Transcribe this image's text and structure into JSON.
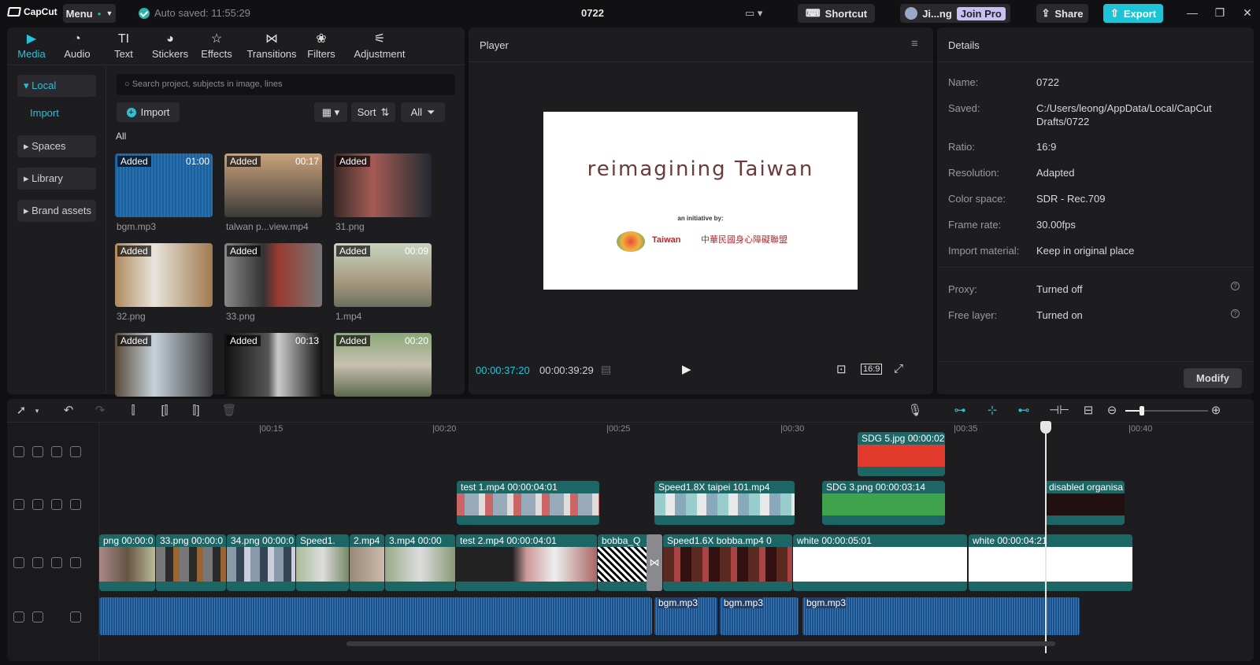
{
  "app": {
    "logo": "CapCut",
    "menu": "Menu",
    "autosave": "Auto saved: 11:55:29",
    "project_title": "0722",
    "shortcut": "Shortcut",
    "user": "Ji...ng",
    "join_pro": "Join Pro",
    "share": "Share",
    "export": "Export"
  },
  "media": {
    "tabs": [
      {
        "label": "Media",
        "icon": "media-icon"
      },
      {
        "label": "Audio",
        "icon": "audio-icon"
      },
      {
        "label": "Text",
        "icon": "text-icon"
      },
      {
        "label": "Stickers",
        "icon": "stickers-icon"
      },
      {
        "label": "Effects",
        "icon": "effects-icon"
      },
      {
        "label": "Transitions",
        "icon": "transitions-icon"
      },
      {
        "label": "Filters",
        "icon": "filters-icon"
      },
      {
        "label": "Adjustment",
        "icon": "adjustment-icon"
      }
    ],
    "nav": {
      "local": "Local",
      "import": "Import",
      "spaces": "Spaces",
      "library": "Library",
      "brand": "Brand assets"
    },
    "search_placeholder": "Search project, subjects in image, lines",
    "import_btn": "Import",
    "sort": "Sort",
    "all_btn": "All",
    "section": "All",
    "items": [
      {
        "name": "bgm.mp3",
        "badge": "Added",
        "dur": "01:00"
      },
      {
        "name": "talwan p...view.mp4",
        "badge": "Added",
        "dur": "00:17"
      },
      {
        "name": "31.png",
        "badge": "Added",
        "dur": ""
      },
      {
        "name": "32.png",
        "badge": "Added",
        "dur": ""
      },
      {
        "name": "33.png",
        "badge": "Added",
        "dur": ""
      },
      {
        "name": "1.mp4",
        "badge": "Added",
        "dur": "00:09"
      },
      {
        "name": "",
        "badge": "Added",
        "dur": ""
      },
      {
        "name": "",
        "badge": "Added",
        "dur": "00:13"
      },
      {
        "name": "",
        "badge": "Added",
        "dur": "00:20"
      }
    ]
  },
  "player": {
    "title": "Player",
    "preview_title": "reimagining Taiwan",
    "preview_sub": "an initiative by:",
    "logo1": "Taiwan",
    "logo2": "中華民國身心障礙聯盟",
    "current": "00:00:37:20",
    "total": "00:00:39:29",
    "ratio": "16:9"
  },
  "details": {
    "title": "Details",
    "rows": [
      {
        "k": "Name:",
        "v": "0722"
      },
      {
        "k": "Saved:",
        "v": "C:/Users/leong/AppData/Local/CapCut Drafts/0722"
      },
      {
        "k": "Ratio:",
        "v": "16:9"
      },
      {
        "k": "Resolution:",
        "v": "Adapted"
      },
      {
        "k": "Color space:",
        "v": "SDR - Rec.709"
      },
      {
        "k": "Frame rate:",
        "v": "30.00fps"
      },
      {
        "k": "Import material:",
        "v": "Keep in original place"
      },
      {
        "k": "Proxy:",
        "v": "Turned off"
      },
      {
        "k": "Free layer:",
        "v": "Turned on"
      }
    ],
    "modify": "Modify"
  },
  "timeline": {
    "ruler": [
      "|00:15",
      "|00:20",
      "|00:25",
      "|00:30",
      "|00:35",
      "|00:40"
    ],
    "clips": {
      "sdg5": "SDG 5.jpg  00:00:02",
      "test1": "test 1.mp4  00:00:04:01",
      "speed1": "Speed1.8X  taipei 101.mp4",
      "sdg3": "SDG 3.png  00:00:03:14",
      "disabled": "disabled organisa",
      "c_png": "png  00:00:0",
      "c33": "33.png  00:00:0",
      "c34": "34.png  00:00:0",
      "c_speed": "Speed1.",
      "c2": "2.mp4",
      "c3": "3.mp4  00:00",
      "test2": "test 2.mp4  00:00:04:01",
      "bobba_q": "bobba_Q",
      "speed16": "Speed1.6X  bobba.mp4  0",
      "white1": "white  00:00:05:01",
      "white2": "white  00:00:04:21",
      "bgm": "bgm.mp3"
    }
  },
  "colors": {
    "accent": "#25c2d9",
    "clip": "#1d6666",
    "audio": "#1c4f86"
  }
}
